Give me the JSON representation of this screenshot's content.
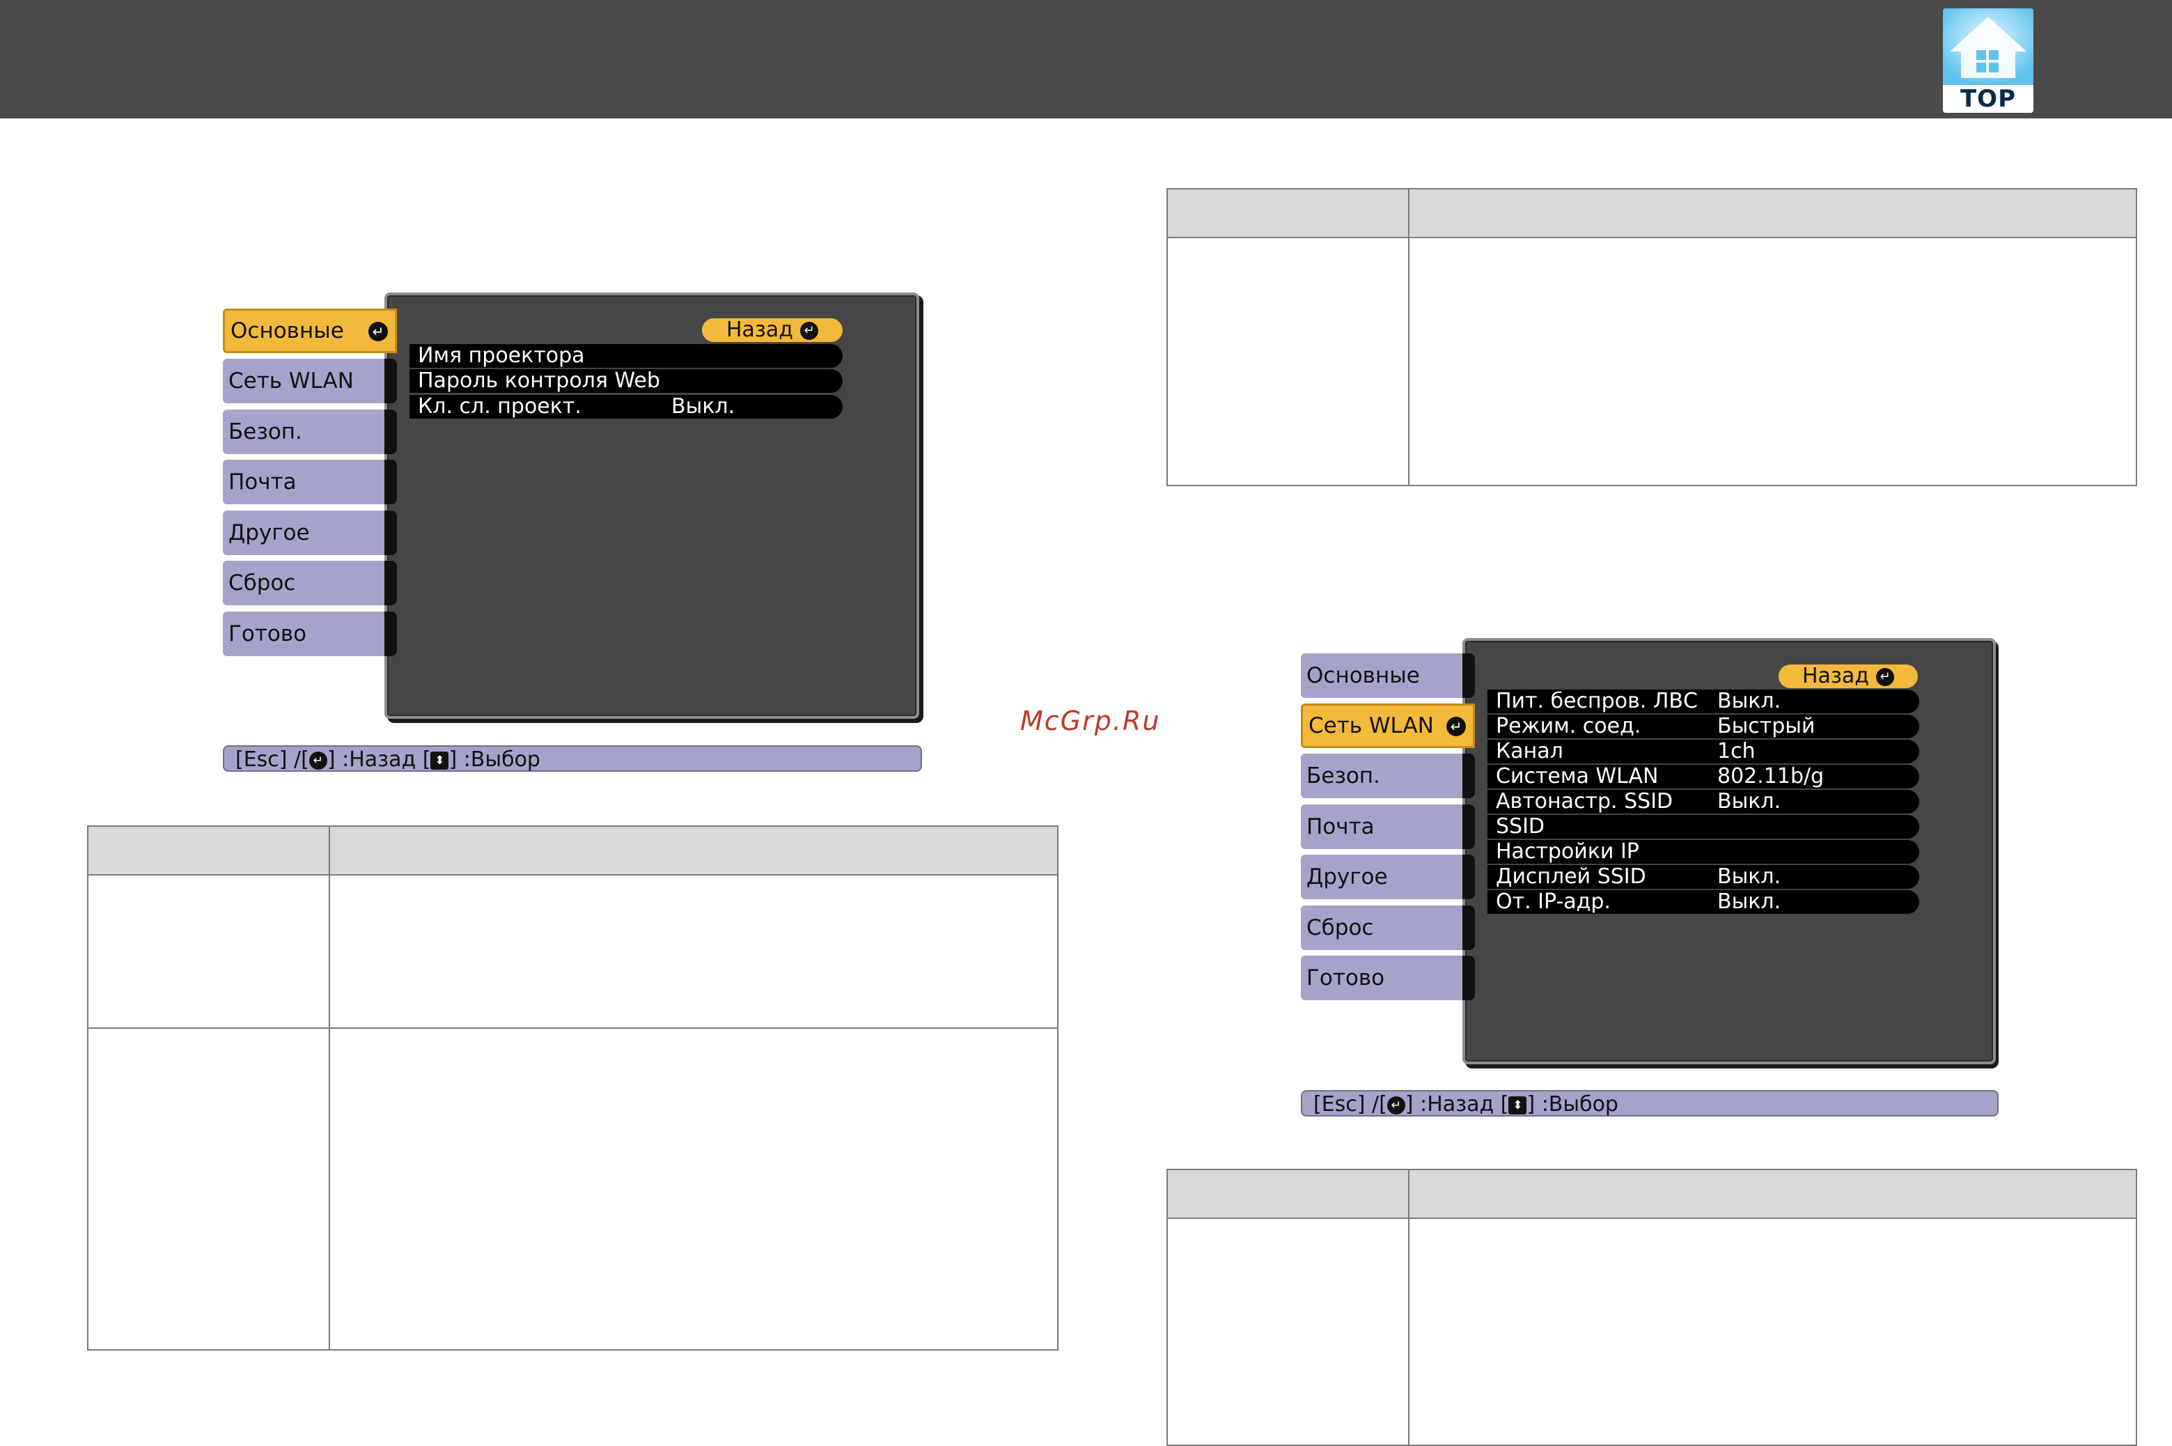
{
  "header": {
    "logo_text": "TOP",
    "logo_icon": "house-icon"
  },
  "watermark": "McGrp.Ru",
  "menu1": {
    "tabs": [
      "Основные",
      "Сеть WLAN",
      "Безоп.",
      "Почта",
      "Другое",
      "Сброс",
      "Готово"
    ],
    "active_tab": 0,
    "back_label": "Назад",
    "rows": [
      {
        "label": "Имя проектора",
        "value": ""
      },
      {
        "label": "Пароль контроля Web",
        "value": ""
      },
      {
        "label": "Кл. сл. проект.",
        "value": "Выкл."
      }
    ],
    "help": {
      "esc": "[Esc] /[",
      "back": "] :Назад  [",
      "select": "] :Выбор"
    }
  },
  "menu2": {
    "tabs": [
      "Основные",
      "Сеть WLAN",
      "Безоп.",
      "Почта",
      "Другое",
      "Сброс",
      "Готово"
    ],
    "active_tab": 1,
    "back_label": "Назад",
    "rows": [
      {
        "label": "Пит. беспров. ЛВС",
        "value": "Выкл."
      },
      {
        "label": "Режим. соед.",
        "value": "Быстрый"
      },
      {
        "label": "Канал",
        "value": "1ch"
      },
      {
        "label": "Система WLAN",
        "value": "802.11b/g"
      },
      {
        "label": "Автонастр. SSID",
        "value": "Выкл."
      },
      {
        "label": "SSID",
        "value": ""
      },
      {
        "label": "Настройки IP",
        "value": ""
      },
      {
        "label": "Дисплей SSID",
        "value": "Выкл."
      },
      {
        "label": "От. IP-адр.",
        "value": "Выкл."
      }
    ],
    "help": {
      "esc": "[Esc] /[",
      "back": "] :Назад  [",
      "select": "] :Выбор"
    }
  },
  "colors": {
    "tab": "#a5a3c9",
    "tab_active": "#f3b93a",
    "menu_bg": "#464646",
    "header": "#4a4a4a"
  }
}
